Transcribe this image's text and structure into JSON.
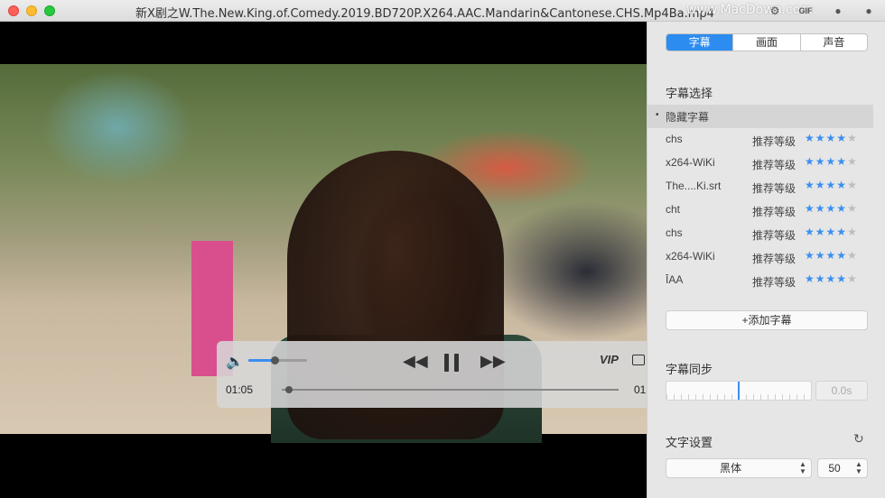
{
  "window": {
    "title": "新X剧之W.The.New.King.of.Comedy.2019.BD720P.X264.AAC.Mandarin&Cantonese.CHS.Mp4Ba.mp4",
    "watermark": "www.MacDown.com"
  },
  "player": {
    "current_time": "01:05",
    "end_time_partial": "01:",
    "volume_fraction": 0.45,
    "progress_fraction": 0.02,
    "vip_label": "VIP"
  },
  "panel": {
    "tabs": [
      {
        "label": "字幕",
        "active": true
      },
      {
        "label": "画面",
        "active": false
      },
      {
        "label": "声音",
        "active": false
      }
    ],
    "subtitle_section_title": "字幕选择",
    "subtitles": [
      {
        "name": "隐藏字幕",
        "selected": true,
        "rec_label": "",
        "rating": null
      },
      {
        "name": "chs",
        "selected": false,
        "rec_label": "推荐等级",
        "rating": 4
      },
      {
        "name": "x264-WiKi",
        "selected": false,
        "rec_label": "推荐等级",
        "rating": 4
      },
      {
        "name": "The....Ki.srt",
        "selected": false,
        "rec_label": "推荐等级",
        "rating": 4
      },
      {
        "name": "cht",
        "selected": false,
        "rec_label": "推荐等级",
        "rating": 4
      },
      {
        "name": "chs",
        "selected": false,
        "rec_label": "推荐等级",
        "rating": 4
      },
      {
        "name": "x264-WiKi",
        "selected": false,
        "rec_label": "推荐等级",
        "rating": 4
      },
      {
        "name": "ĪAA",
        "selected": false,
        "rec_label": "推荐等级",
        "rating": 4
      }
    ],
    "add_subtitle_label": "+添加字幕",
    "sync_section_title": "字幕同步",
    "sync_value": "0.0s",
    "text_section_title": "文字设置",
    "font_value": "黑体",
    "size_value": "50"
  },
  "colors": {
    "accent": "#2d8cf0",
    "star_on": "#3a8ff0",
    "star_off": "#bdbdbd"
  }
}
